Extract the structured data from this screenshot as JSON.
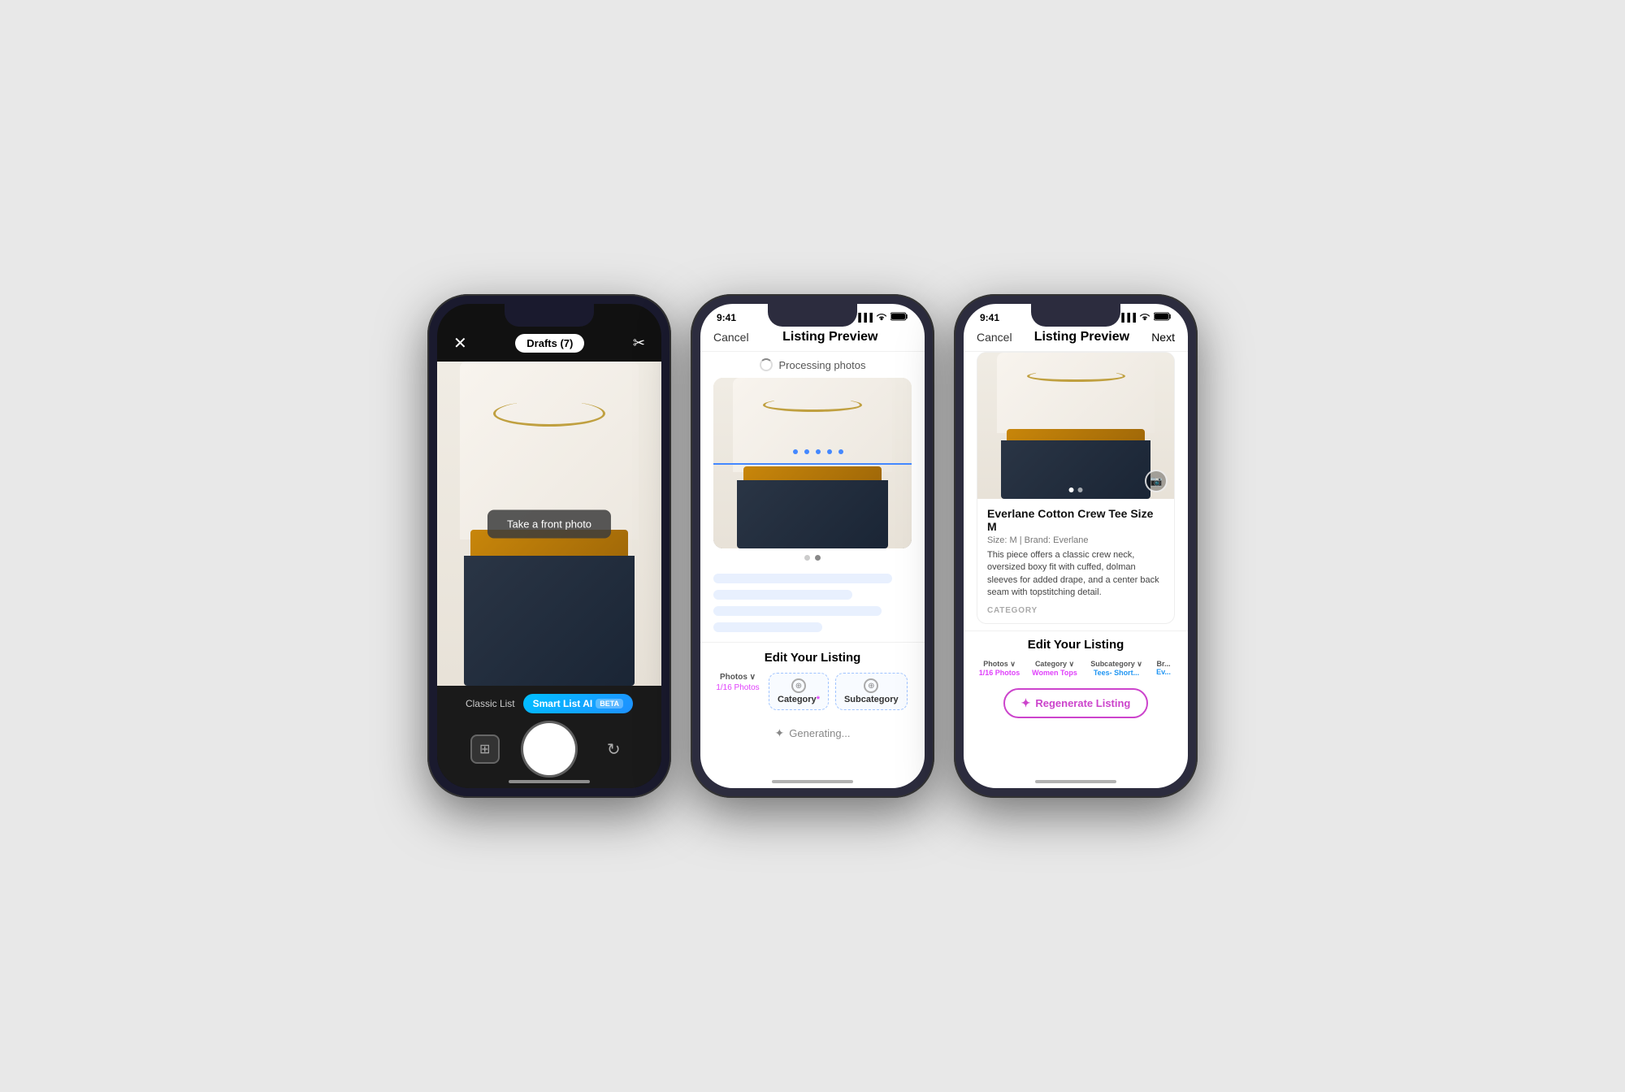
{
  "phone1": {
    "top_bar": {
      "close_label": "✕",
      "drafts_label": "Drafts (7)",
      "scissors_label": "✂"
    },
    "camera": {
      "take_photo_label": "Take a front photo"
    },
    "bottom": {
      "mode_classic_label": "Classic List",
      "mode_smart_label": "Smart List AI",
      "beta_label": "BETA",
      "gallery_icon": "⊞",
      "flip_icon": "⟳"
    }
  },
  "phone2": {
    "status": {
      "time": "9:41",
      "signal": "▐▐▐",
      "wifi": "WiFi",
      "battery": "🔋"
    },
    "nav": {
      "cancel_label": "Cancel",
      "title": "Listing Preview",
      "next_label": ""
    },
    "processing": {
      "label": "Processing photos"
    },
    "image": {
      "dots": [
        {
          "active": false
        },
        {
          "active": true
        }
      ]
    },
    "edit_section": {
      "title": "Edit Your Listing",
      "tabs": [
        {
          "top_label": "Photos",
          "bottom_label": "1/16 Photos",
          "type": "plain"
        },
        {
          "top_label": "",
          "icon": "⊕",
          "box_label": "Category",
          "required": true,
          "type": "box"
        },
        {
          "top_label": "",
          "icon": "⊕",
          "box_label": "Subcategory",
          "required": false,
          "type": "box"
        }
      ]
    },
    "generating": {
      "label": "Generating..."
    }
  },
  "phone3": {
    "status": {
      "time": "9:41",
      "signal": "▐▐▐",
      "wifi": "WiFi",
      "battery": "🔋"
    },
    "nav": {
      "cancel_label": "Cancel",
      "title": "Listing Preview",
      "next_label": "Next"
    },
    "listing": {
      "title": "Everlane Cotton Crew Tee Size M",
      "meta": "Size: M  |  Brand: Everlane",
      "description": "This piece offers a classic crew neck, oversized boxy fit with cuffed, dolman sleeves for added drape, and a center back seam with topstitching detail.",
      "category_label": "CATEGORY",
      "image_dots": [
        {
          "active": true
        },
        {
          "active": false
        }
      ]
    },
    "edit_section": {
      "title": "Edit Your Listing",
      "tabs": [
        {
          "top_label": "Photos",
          "bottom_label": "1/16 Photos",
          "type": "plain"
        },
        {
          "top_label": "Category",
          "bottom_label": "Women Tops",
          "color": "pink",
          "type": "plain"
        },
        {
          "top_label": "Subcategory",
          "bottom_label": "Tees- Short...",
          "color": "blue",
          "type": "plain"
        },
        {
          "top_label": "Br...",
          "bottom_label": "Ev...",
          "color": "blue",
          "type": "plain"
        }
      ]
    },
    "regen_button": {
      "label": "Regenerate Listing",
      "sparkle": "✦"
    }
  }
}
